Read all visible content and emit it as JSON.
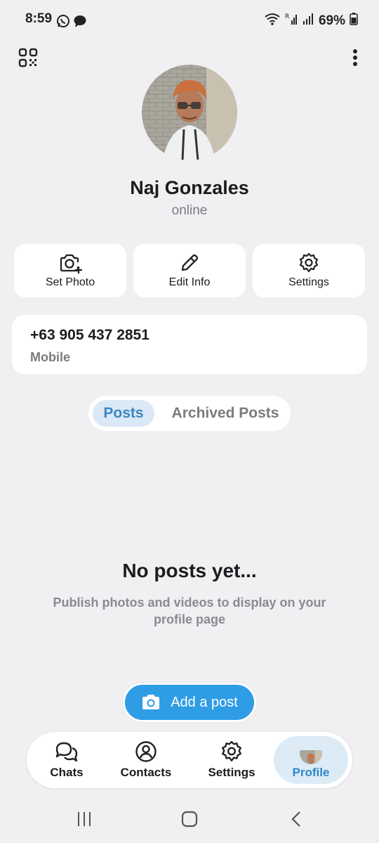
{
  "status_bar": {
    "time": "8:59",
    "battery": "69%",
    "icons": [
      "whatsapp-icon",
      "message-bubble-icon",
      "wifi-icon",
      "signal-icon",
      "battery-icon"
    ]
  },
  "header": {
    "qr_icon": "qr-code-icon",
    "menu_icon": "more-vert-icon"
  },
  "profile": {
    "name": "Naj Gonzales",
    "status": "online"
  },
  "actions": [
    {
      "label": "Set Photo",
      "icon": "camera-plus-icon"
    },
    {
      "label": "Edit Info",
      "icon": "pencil-icon"
    },
    {
      "label": "Settings",
      "icon": "gear-icon"
    }
  ],
  "info": {
    "phone": "+63 905 437 2851",
    "phone_label": "Mobile"
  },
  "tabs": {
    "posts": "Posts",
    "archived": "Archived Posts",
    "active": "Posts"
  },
  "empty_state": {
    "title": "No posts yet...",
    "description": "Publish photos and videos to display on your profile page"
  },
  "add_post": {
    "label": "Add a post"
  },
  "bottom_nav": [
    {
      "label": "Chats",
      "icon": "chat-icon"
    },
    {
      "label": "Contacts",
      "icon": "person-icon"
    },
    {
      "label": "Settings",
      "icon": "gear-icon"
    },
    {
      "label": "Profile",
      "icon": "avatar"
    }
  ],
  "colors": {
    "accent": "#2f9de6",
    "active_tab_bg": "#dbe8f5",
    "background": "#f0f0f3"
  }
}
